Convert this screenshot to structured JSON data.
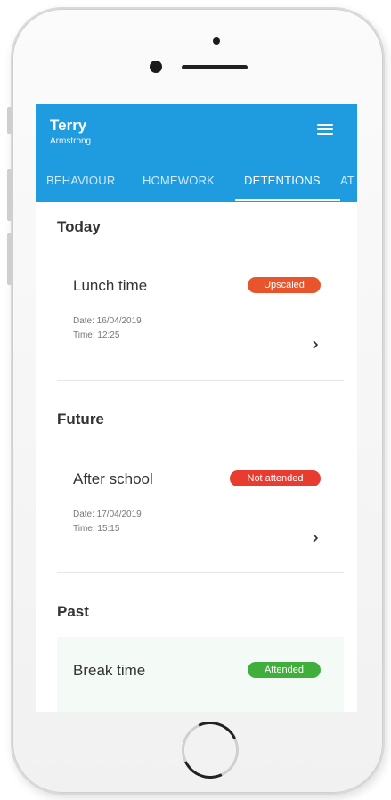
{
  "header": {
    "name": "Terry",
    "subname": "Armstrong",
    "menu_icon": "hamburger-menu-icon"
  },
  "tabs": [
    {
      "label": "BEHAVIOUR"
    },
    {
      "label": "HOMEWORK"
    },
    {
      "label": "DETENTIONS"
    },
    {
      "label": "AT"
    }
  ],
  "active_tab": "DETENTIONS",
  "sections": {
    "today": {
      "title": "Today",
      "item": {
        "title": "Lunch time",
        "badge": "Upscaled",
        "badge_color": "#e8552d",
        "date": "Date: 16/04/2019",
        "time": "Time: 12:25"
      }
    },
    "future": {
      "title": "Future",
      "item": {
        "title": "After school",
        "badge": "Not attended",
        "badge_color": "#e73c2f",
        "date": "Date: 17/04/2019",
        "time": "Time: 15:15"
      }
    },
    "past": {
      "title": "Past",
      "item": {
        "title": "Break time",
        "badge": "Attended",
        "badge_color": "#3fae3a"
      }
    }
  },
  "colors": {
    "accent": "#1f9be0"
  }
}
